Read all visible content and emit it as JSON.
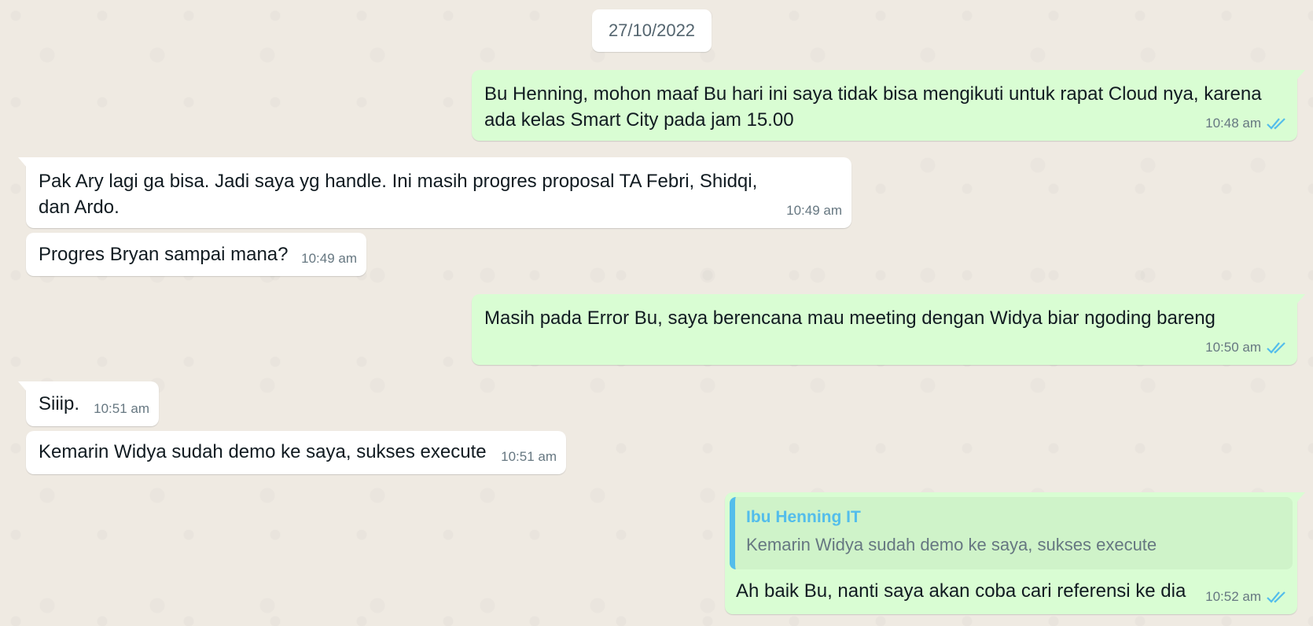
{
  "chat": {
    "date_label": "27/10/2022",
    "messages": [
      {
        "dir": "out",
        "text": "Bu Henning, mohon maaf Bu hari ini saya tidak bisa mengikuti untuk rapat Cloud nya, karena ada kelas Smart City pada jam 15.00",
        "time": "10:48 am",
        "status": "read"
      },
      {
        "dir": "in",
        "text": "Pak Ary lagi ga bisa. Jadi saya yg handle. Ini masih progres proposal TA Febri, Shidqi, dan Ardo.",
        "time": "10:49 am"
      },
      {
        "dir": "in",
        "text": "Progres Bryan sampai mana?",
        "time": "10:49 am"
      },
      {
        "dir": "out",
        "text": "Masih pada Error Bu, saya berencana mau meeting dengan Widya biar ngoding bareng",
        "time": "10:50 am",
        "status": "read"
      },
      {
        "dir": "in",
        "text": "Siiip.",
        "time": "10:51 am"
      },
      {
        "dir": "in",
        "text": "Kemarin Widya sudah demo ke saya, sukses execute",
        "time": "10:51 am"
      },
      {
        "dir": "out",
        "text": "Ah baik Bu, nanti saya akan coba cari referensi ke dia",
        "time": "10:52 am",
        "status": "read",
        "quote": {
          "author": "Ibu Henning IT",
          "text": "Kemarin Widya sudah demo ke saya, sukses execute"
        }
      }
    ]
  },
  "colors": {
    "background": "#efeae2",
    "incoming_bubble": "#ffffff",
    "outgoing_bubble": "#d9fdd3",
    "read_ticks": "#53bdeb",
    "quote_accent": "#53bdeb"
  },
  "icons": {
    "read_receipt": "double-check-icon"
  }
}
